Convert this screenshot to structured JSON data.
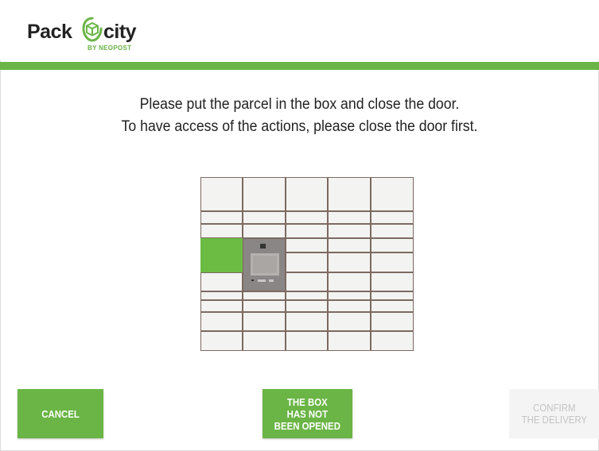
{
  "header": {
    "logo_word_left": "Pack",
    "logo_word_right": "city",
    "logo_subtitle": "BY NEOPOST",
    "accent_color": "#6ab545"
  },
  "instructions": {
    "line1": "Please put the parcel in the box and close the door.",
    "line2": "To have access of the actions, please close the door first."
  },
  "locker": {
    "selected_color": "#6cbc44",
    "selected_compartment": "column 1, middle"
  },
  "actions": {
    "cancel_label": "CANCEL",
    "not_opened_label": "THE BOX\nHAS NOT\nBEEN OPENED",
    "confirm_label": "CONFIRM\nTHE DELIVERY",
    "confirm_state": "disabled"
  }
}
